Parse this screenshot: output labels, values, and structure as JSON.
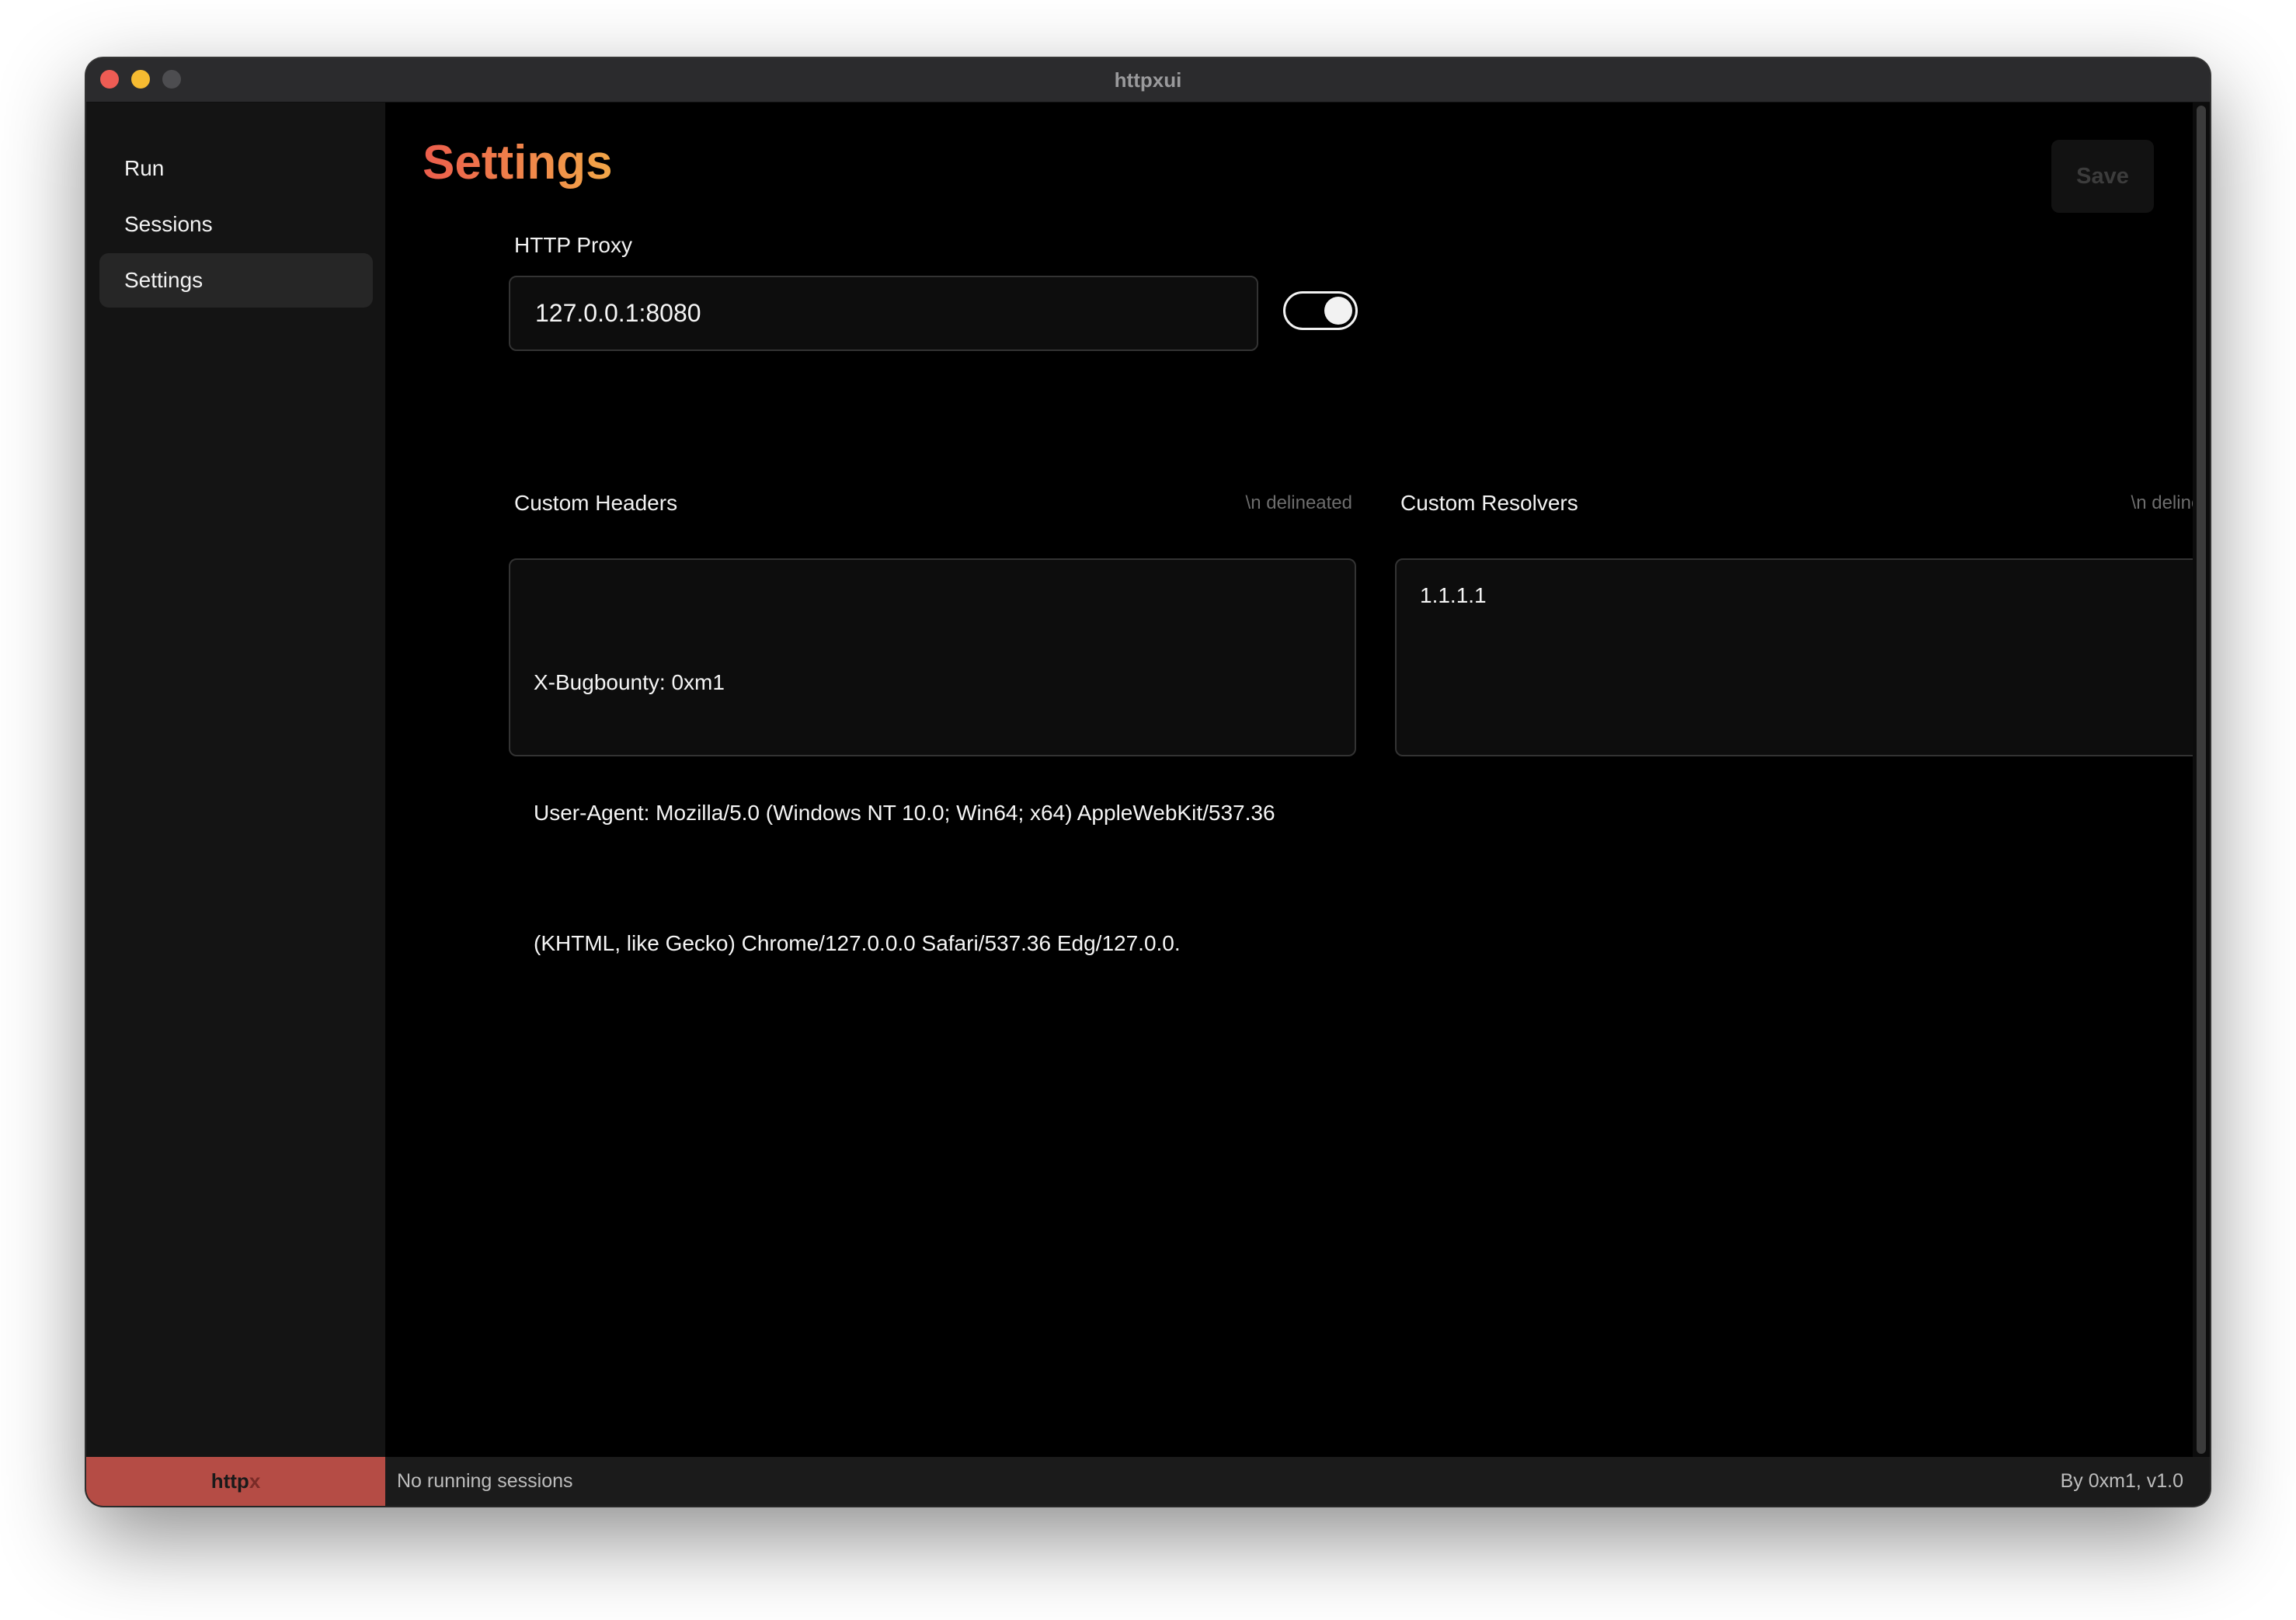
{
  "window": {
    "title": "httpxui"
  },
  "sidebar": {
    "items": [
      {
        "label": "Run"
      },
      {
        "label": "Sessions"
      },
      {
        "label": "Settings",
        "active": true
      }
    ]
  },
  "page": {
    "title": "Settings",
    "save_label": "Save"
  },
  "proxy": {
    "label": "HTTP Proxy",
    "value": "127.0.0.1:8080",
    "enabled": true
  },
  "custom_headers": {
    "label": "Custom Headers",
    "hint": "\\n delineated",
    "lines": [
      "X-Bugbounty: 0xm1",
      "User-Agent: Mozilla/5.0 (Windows NT 10.0; Win64; x64) AppleWebKit/537.36",
      "(KHTML, like Gecko) Chrome/127.0.0.0 Safari/537.36 Edg/127.0.0."
    ]
  },
  "custom_resolvers": {
    "label": "Custom Resolvers",
    "hint": "\\n delineated",
    "value": "1.1.1.1"
  },
  "statusbar": {
    "brand_text": "http",
    "brand_suffix": "x",
    "status": "No running sessions",
    "version": "By 0xm1, v1.0"
  },
  "colors": {
    "title_gradient_start": "#ec5d4c",
    "title_gradient_end": "#f2a748",
    "brand_bg": "#b54c45"
  }
}
